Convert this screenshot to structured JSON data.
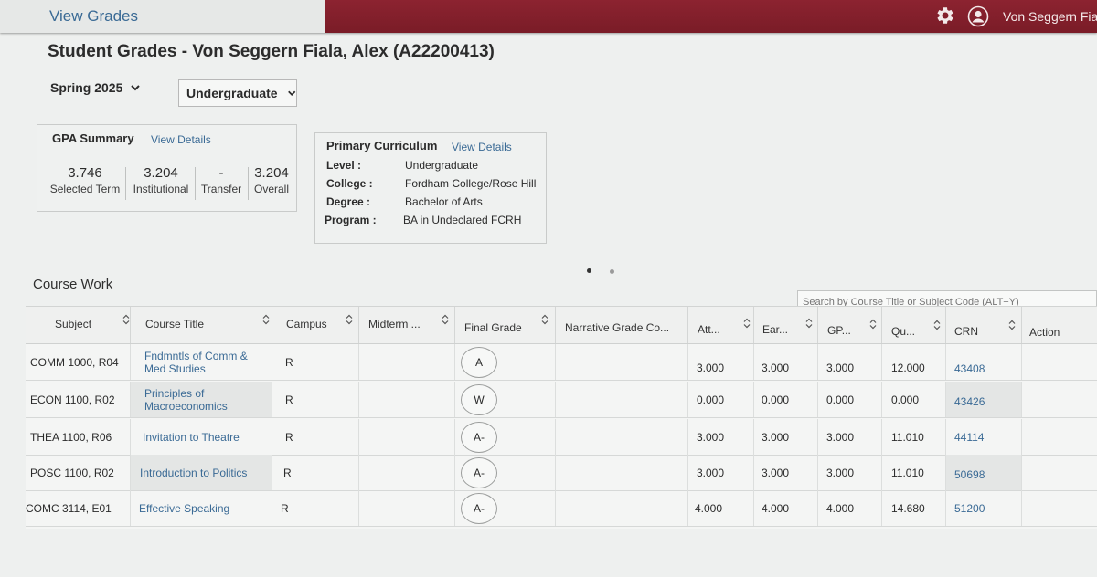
{
  "header": {
    "app_title": "View Grades",
    "user_name": "Von Seggern Fiala,",
    "settings_icon": "gear-icon",
    "user_icon": "user-avatar-icon",
    "brand_color": "#7f1e2a"
  },
  "page": {
    "title": "Student Grades - Von Seggern Fiala, Alex (A22200413)"
  },
  "filters": {
    "term": "Spring 2025",
    "level": "Undergraduate"
  },
  "gpa_summary": {
    "title": "GPA Summary",
    "link": "View Details",
    "items": [
      {
        "value": "3.746",
        "label": "Selected Term"
      },
      {
        "value": "3.204",
        "label": "Institutional"
      },
      {
        "value": "-",
        "label": "Transfer"
      },
      {
        "value": "3.204",
        "label": "Overall"
      }
    ]
  },
  "curriculum": {
    "title": "Primary Curriculum",
    "link": "View Details",
    "rows": [
      {
        "key": "Level :",
        "value": "Undergraduate"
      },
      {
        "key": "College :",
        "value": "Fordham College/Rose Hill"
      },
      {
        "key": "Degree :",
        "value": "Bachelor of Arts"
      },
      {
        "key": "Program :",
        "value": "BA in Undeclared FCRH"
      }
    ]
  },
  "course_work": {
    "title": "Course Work",
    "search_placeholder": "Search by Course Title or Subject Code (ALT+Y)",
    "columns": [
      "Subject",
      "Course Title",
      "Campus",
      "Midterm ...",
      "Final Grade",
      "Narrative Grade Co...",
      "Att...",
      "Ear...",
      "GP...",
      "Qu...",
      "CRN",
      "Action"
    ],
    "rows": [
      {
        "subject": "COMM 1000, R04",
        "title": "Fndmntls of Comm & Med Studies",
        "campus": "R",
        "midterm": "",
        "final": "A",
        "narrative": "",
        "att": "3.000",
        "ear": "3.000",
        "gp": "3.000",
        "qu": "12.000",
        "crn": "43408",
        "action": ""
      },
      {
        "subject": "ECON 1100, R02",
        "title": "Principles of Macroeconomics",
        "campus": "R",
        "midterm": "",
        "final": "W",
        "narrative": "",
        "att": "0.000",
        "ear": "0.000",
        "gp": "0.000",
        "qu": "0.000",
        "crn": "43426",
        "action": ""
      },
      {
        "subject": "THEA 1100, R06",
        "title": "Invitation to Theatre",
        "campus": "R",
        "midterm": "",
        "final": "A-",
        "narrative": "",
        "att": "3.000",
        "ear": "3.000",
        "gp": "3.000",
        "qu": "11.010",
        "crn": "44114",
        "action": ""
      },
      {
        "subject": "POSC 1100, R02",
        "title": "Introduction to Politics",
        "campus": "R",
        "midterm": "",
        "final": "A-",
        "narrative": "",
        "att": "3.000",
        "ear": "3.000",
        "gp": "3.000",
        "qu": "11.010",
        "crn": "50698",
        "action": ""
      },
      {
        "subject": "COMC 3114, E01",
        "title": "Effective Speaking",
        "campus": "R",
        "midterm": "",
        "final": "A-",
        "narrative": "",
        "att": "4.000",
        "ear": "4.000",
        "gp": "4.000",
        "qu": "14.680",
        "crn": "51200",
        "action": ""
      }
    ]
  }
}
